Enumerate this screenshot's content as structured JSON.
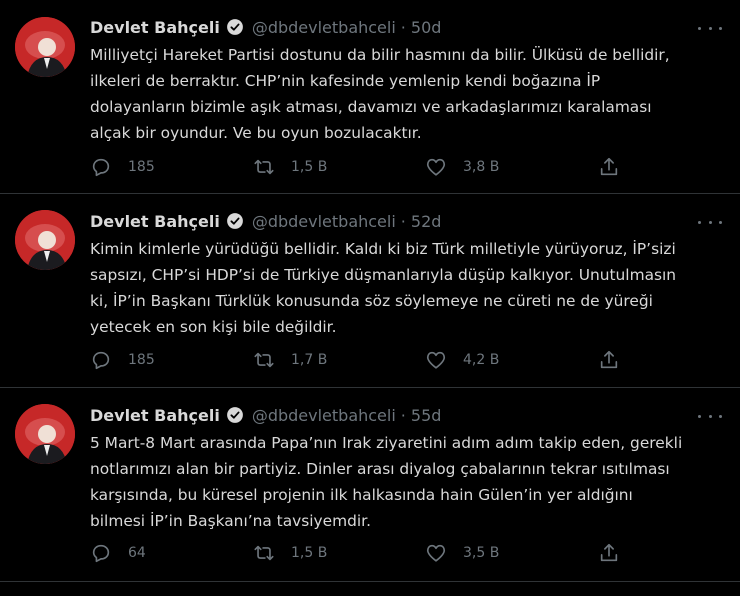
{
  "tweets": [
    {
      "name": "Devlet Bahçeli",
      "handle": "@dbdevletbahceli",
      "separator": "·",
      "time": "50d",
      "text": "Milliyetçi Hareket Partisi dostunu da bilir hasmını da bilir. Ülküsü de bellidir,\nilkeleri de berraktır. CHP’nin kafesinde yemlenip kendi boğazına İP\ndolayanların bizimle aşık atması, davamızı ve arkadaşlarımızı karalaması\nalçak bir oyundur. Ve bu oyun bozulacaktır.",
      "replies": "185",
      "retweets": "1,5 B",
      "likes": "3,8 B"
    },
    {
      "name": "Devlet Bahçeli",
      "handle": "@dbdevletbahceli",
      "separator": "·",
      "time": "52d",
      "text": "Kimin kimlerle yürüdüğü bellidir. Kaldı ki biz Türk milletiyle yürüyoruz, İP’sizi\nsapsızı, CHP’si HDP’si de Türkiye düşmanlarıyla düşüp kalkıyor. Unutulmasın\nki, İP’in Başkanı Türklük konusunda söz söylemeye ne cüreti ne de yüreği\nyetecek en son kişi bile değildir.",
      "replies": "185",
      "retweets": "1,7 B",
      "likes": "4,2 B"
    },
    {
      "name": "Devlet Bahçeli",
      "handle": "@dbdevletbahceli",
      "separator": "·",
      "time": "55d",
      "text": "5 Mart-8 Mart arasında Papa’nın Irak ziyaretini adım adım takip eden, gerekli\nnotlarımızı alan bir partiyiz. Dinler arası diyalog çabalarının tekrar ısıtılması\nkarşısında, bu küresel projenin ilk halkasında hain Gülen’in yer aldığını\nbilmesi İP’in Başkanı’na tavsiyemdir.",
      "replies": "64",
      "retweets": "1,5 B",
      "likes": "3,5 B"
    }
  ],
  "colors": {
    "background": "#000000",
    "text": "#d9d9d9",
    "secondary": "#6e767d",
    "verified": "#d9d9d9",
    "divider": "#2f3336"
  },
  "icons": {
    "reply": "reply-icon",
    "retweet": "retweet-icon",
    "like": "heart-icon",
    "share": "share-icon",
    "verified": "verified-badge-icon",
    "more": "more-options-icon"
  }
}
